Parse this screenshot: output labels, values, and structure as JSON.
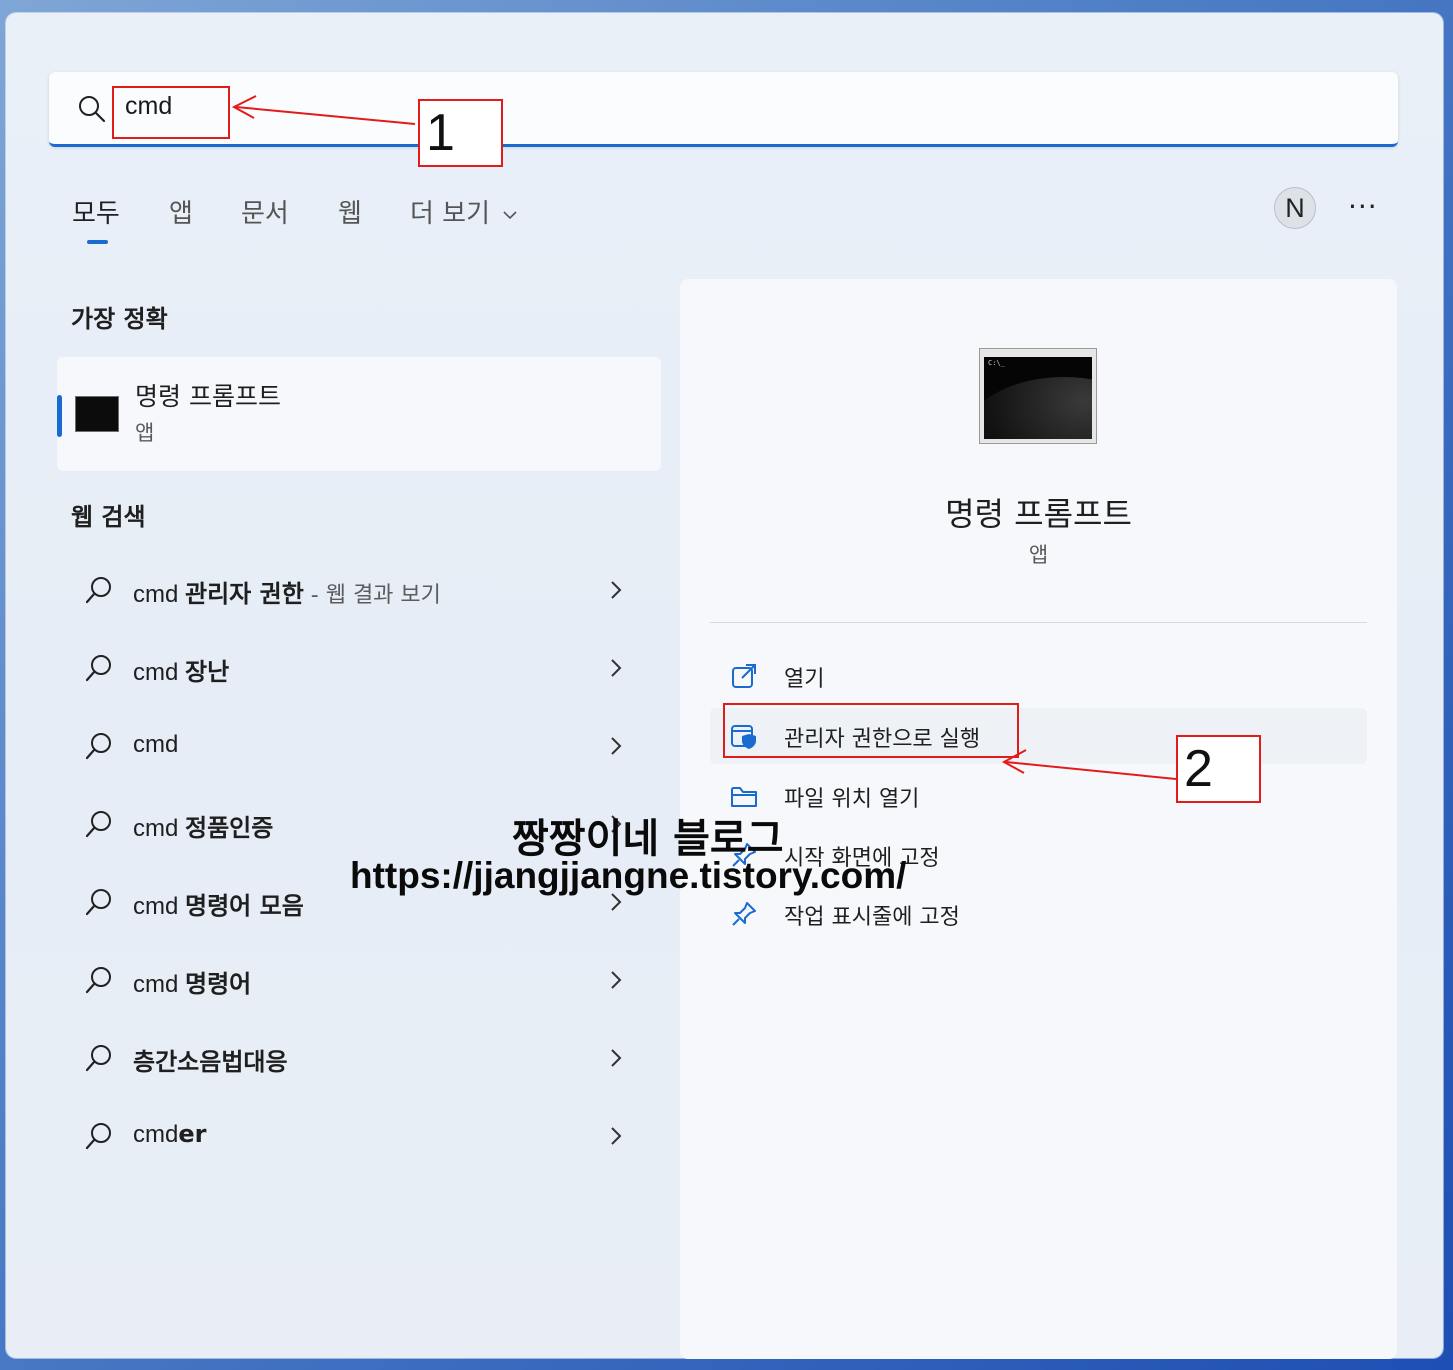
{
  "search": {
    "query": "cmd"
  },
  "tabs": [
    {
      "label": "모두"
    },
    {
      "label": "앱"
    },
    {
      "label": "문서"
    },
    {
      "label": "웹"
    },
    {
      "label": "더 보기"
    }
  ],
  "user": {
    "initial": "N"
  },
  "more_menu": "···",
  "best_match": {
    "section_title": "가장 정확",
    "name": "명령 프롬프트",
    "kind": "앱"
  },
  "web_search": {
    "section_title": "웹 검색",
    "items": [
      {
        "pre": "cmd ",
        "bold": "관리자 권한",
        "suffix": " - 웹 결과 보기"
      },
      {
        "pre": "cmd ",
        "bold": "장난",
        "suffix": ""
      },
      {
        "pre": "cmd",
        "bold": "",
        "suffix": ""
      },
      {
        "pre": "cmd ",
        "bold": "정품인증",
        "suffix": ""
      },
      {
        "pre": "cmd ",
        "bold": "명령어 모음",
        "suffix": ""
      },
      {
        "pre": "cmd ",
        "bold": "명령어",
        "suffix": ""
      },
      {
        "pre": "",
        "bold": "층간소음법대응",
        "suffix": ""
      },
      {
        "pre": "cmd",
        "bold": "er",
        "suffix": ""
      }
    ]
  },
  "detail": {
    "name": "명령 프롬프트",
    "kind": "앱",
    "icon_prompt": "C:\\_",
    "actions": [
      {
        "label": "열기",
        "icon": "open-external-icon"
      },
      {
        "label": "관리자 권한으로 실행",
        "icon": "admin-shield-icon"
      },
      {
        "label": "파일 위치 열기",
        "icon": "folder-icon"
      },
      {
        "label": "시작 화면에 고정",
        "icon": "pin-icon"
      },
      {
        "label": "작업 표시줄에 고정",
        "icon": "pin-icon"
      }
    ]
  },
  "annotations": {
    "step1": "1",
    "step2": "2",
    "color": "#e21b1b"
  },
  "watermark": {
    "line1": "짱짱이네 블로그",
    "line2": "https://jjangjjangne.tistory.com/"
  },
  "colors": {
    "accent": "#1a6bd0"
  }
}
